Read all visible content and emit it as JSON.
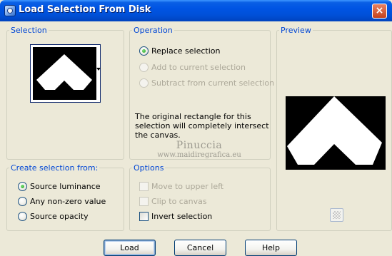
{
  "window": {
    "title": "Load Selection From Disk",
    "close_label": "×"
  },
  "selection": {
    "legend": "Selection"
  },
  "operation": {
    "legend": "Operation",
    "options": [
      {
        "label": "Replace selection",
        "checked": true,
        "enabled": true
      },
      {
        "label": "Add to current selection",
        "checked": false,
        "enabled": false
      },
      {
        "label": "Subtract from current selection",
        "checked": false,
        "enabled": false
      }
    ],
    "info": "The original rectangle for this selection will completely intersect the canvas."
  },
  "preview": {
    "legend": "Preview"
  },
  "watermark": {
    "name": "Pinuccia",
    "url": "www.maidiregrafica.eu"
  },
  "create_from": {
    "legend": "Create selection from:",
    "options": [
      {
        "label": "Source luminance",
        "checked": true
      },
      {
        "label": "Any non-zero value",
        "checked": false
      },
      {
        "label": "Source opacity",
        "checked": false
      }
    ]
  },
  "options": {
    "legend": "Options",
    "items": [
      {
        "label": "Move to upper left",
        "checked": false,
        "enabled": false
      },
      {
        "label": "Clip to canvas",
        "checked": false,
        "enabled": false
      },
      {
        "label": "Invert selection",
        "checked": false,
        "enabled": true
      }
    ]
  },
  "buttons": {
    "load": "Load",
    "cancel": "Cancel",
    "help": "Help"
  },
  "colors": {
    "title_bar": "#0054E3",
    "legend_text": "#0046D5",
    "dialog_bg": "#ECE9D8",
    "radio_dot": "#21A121"
  }
}
